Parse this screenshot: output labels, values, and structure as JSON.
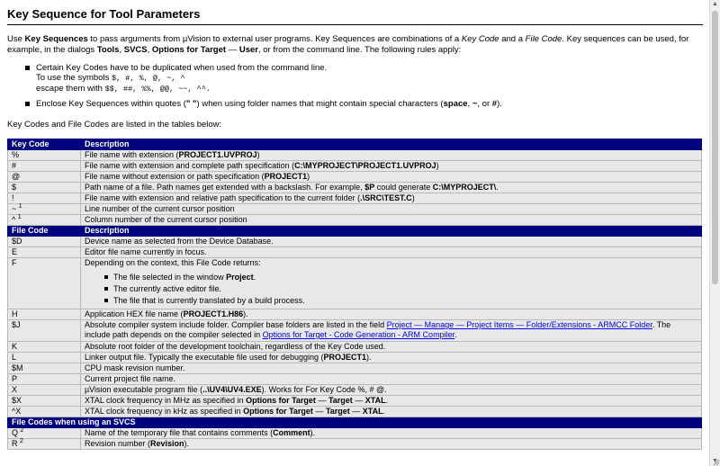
{
  "title": "Key Sequence for Tool Parameters",
  "intro": {
    "t1": "Use ",
    "b1": "Key Sequences",
    "t2": " to pass arguments from µVision to external user programs. Key Sequences are combinations of a ",
    "i1": "Key Code",
    "t3": " and a ",
    "i2": "File Code",
    "t4": ". Key sequences can be used, for example, in the dialogs ",
    "b2": "Tools",
    "t5": ", ",
    "b3": "SVCS",
    "t6": ", ",
    "b4": "Options for Target",
    "t7": " — ",
    "b5": "User",
    "t8": ", or from the command line. The following rules apply:"
  },
  "rules": {
    "r1_line1": "Certain Key Codes have to be duplicated when used from the command line.",
    "r1_line2": "To use the symbols ",
    "r1_symbols": "$, #, %, @, ~, ^",
    "r1_line3": "escape them with ",
    "r1_escaped": "$$, ##, %%, @@, ~~, ^^.",
    "r2_t1": "Enclose Key Sequences within quotes (",
    "r2_b1": "\" \"",
    "r2_t2": ") when using folder names that might contain special characters (",
    "r2_b2": "space",
    "r2_t3": ", ",
    "r2_b3": "~",
    "r2_t4": ", or ",
    "r2_b4": "#",
    "r2_t5": ")."
  },
  "tables_intro": "Key Codes and File Codes are listed in the tables below:",
  "key_codes": {
    "header_code": "Key Code",
    "header_desc": "Description",
    "rows": [
      {
        "code": "%",
        "t": "File name with extension (",
        "b": "PROJECT1.UVPROJ",
        "t2": ")"
      },
      {
        "code": "#",
        "t": "File name with extension and complete path specification (",
        "b": "C:\\MYPROJECT\\PROJECT1.UVPROJ",
        "t2": ")"
      },
      {
        "code": "@",
        "t": "File name without extension or path specification (",
        "b": "PROJECT1",
        "t2": ")"
      },
      {
        "code": "$",
        "t": "Path name of a file. Path names get extended with a backslash. For example, ",
        "b": "$P",
        "t2": " could generate ",
        "b2": "C:\\MYPROJECT\\",
        "t3": "."
      },
      {
        "code": "!",
        "t": "File name with extension and relative path specification to the current folder (",
        "b": ".\\SRC\\TEST.C",
        "t2": ")"
      },
      {
        "code": "~",
        "sup": "1",
        "t": "Line number of the current cursor position"
      },
      {
        "code": "^",
        "sup": "1",
        "t": "Column number of the current cursor position"
      }
    ]
  },
  "file_codes": {
    "header_code": "File Code",
    "header_desc": "Description",
    "rows": {
      "d": {
        "code": "$D",
        "t": "Device name as selected from the Device Database."
      },
      "e": {
        "code": "E",
        "t": "Editor file name currently in focus."
      },
      "f": {
        "code": "F",
        "t": "Depending on the context, this File Code returns:",
        "b1_t": "The file selected in the window ",
        "b1_b": "Project",
        "b1_t2": ".",
        "b2": "The currently active editor file.",
        "b3": "The file that is currently translated by a build process."
      },
      "h": {
        "code": "H",
        "t": "Application HEX file name (",
        "b": "PROJECT1.H86",
        "t2": ")."
      },
      "j": {
        "code": "$J",
        "t": "Absolute compiler system include folder. Compiler base folders are listed in the field ",
        "link1": "Project — Manage — Project Items — Folder/Extensions - ARMCC Folder",
        "t2": ". The include path depends on the compiler selected in ",
        "link2": "Options for Target - Code Generation - ARM Compiler",
        "t3": "."
      },
      "k": {
        "code": "K",
        "t": "Absolute root folder of the development toolchain, regardless of the Key Code used."
      },
      "l": {
        "code": "L",
        "t": "Linker output file. Typically the executable file used for debugging (",
        "b": "PROJECT1",
        "t2": ")."
      },
      "m": {
        "code": "$M",
        "t": "CPU mask revision number."
      },
      "p": {
        "code": "P",
        "t": "Current project file name."
      },
      "x": {
        "code": "X",
        "t": "µVision executable program file (",
        "b": "..\\UV4\\UV4.EXE",
        "t2": "). Works for For Key Code %, # @."
      },
      "xs": {
        "code": "$X",
        "t": "XTAL clock frequency in MHz as specified in ",
        "b": "Options for Target",
        "t2": " — ",
        "b2": "Target",
        "t3": " — ",
        "b3": "XTAL",
        "t4": "."
      },
      "xc": {
        "code": "^X",
        "t": "XTAL clock frequency in kHz as specified in ",
        "b": "Options for Target",
        "t2": " — ",
        "b2": "Target",
        "t3": " — ",
        "b3": "XTAL",
        "t4": "."
      }
    }
  },
  "svcs": {
    "header": "File Codes when using an SVCS",
    "rows": [
      {
        "code": "Q",
        "sup": "2",
        "t": "Name of the temporary file that contains comments (",
        "b": "Comment",
        "t2": ")."
      },
      {
        "code": "R",
        "sup": "2",
        "t": "Revision number (",
        "b": "Revision",
        "t2": ")."
      }
    ]
  },
  "colors": {
    "header_bg": "#000080",
    "row_bg": "#e8e8e8",
    "link": "#0000ee"
  }
}
